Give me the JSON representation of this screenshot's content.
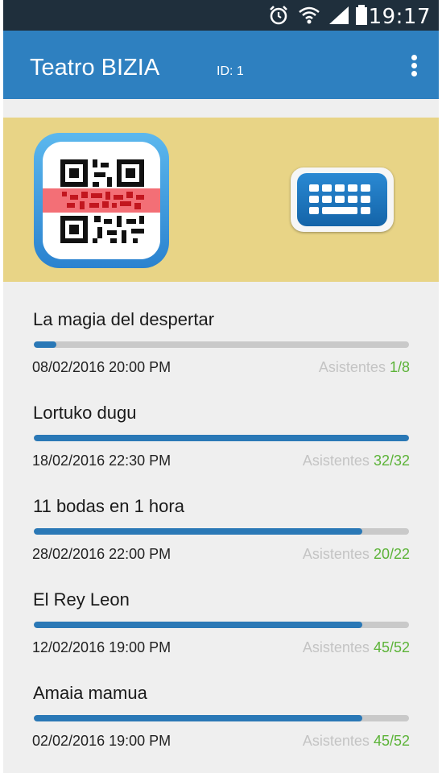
{
  "status_bar": {
    "time": "19:17",
    "icons": [
      "alarm-icon",
      "wifi-icon",
      "signal-icon",
      "battery-icon"
    ]
  },
  "app_bar": {
    "title": "Teatro BIZIA",
    "id_label": "ID: 1",
    "menu_icon": "overflow-menu-icon"
  },
  "banner": {
    "scan_icon": "qr-scan-icon",
    "keyboard_icon": "keyboard-icon"
  },
  "events": [
    {
      "name": "La magia del despertar",
      "date": "08/02/2016 20:00 PM",
      "attendees_label": "Asistentes",
      "attendees": "1/8",
      "progress": 0.06
    },
    {
      "name": "Lortuko dugu",
      "date": "18/02/2016 22:30 PM",
      "attendees_label": "Asistentes",
      "attendees": "32/32",
      "progress": 1.0
    },
    {
      "name": "11 bodas en 1 hora",
      "date": "28/02/2016 22:00 PM",
      "attendees_label": "Asistentes",
      "attendees": "20/22",
      "progress": 0.875
    },
    {
      "name": "El Rey Leon",
      "date": "12/02/2016 19:00 PM",
      "attendees_label": "Asistentes",
      "attendees": "45/52",
      "progress": 0.875
    },
    {
      "name": "Amaia mamua",
      "date": "02/02/2016 19:00 PM",
      "attendees_label": "Asistentes",
      "attendees": "45/52",
      "progress": 0.875
    }
  ],
  "colors": {
    "app_bar": "#2e80c0",
    "banner": "#e8d486",
    "progress": "#2a78b6",
    "count": "#5cb338"
  }
}
